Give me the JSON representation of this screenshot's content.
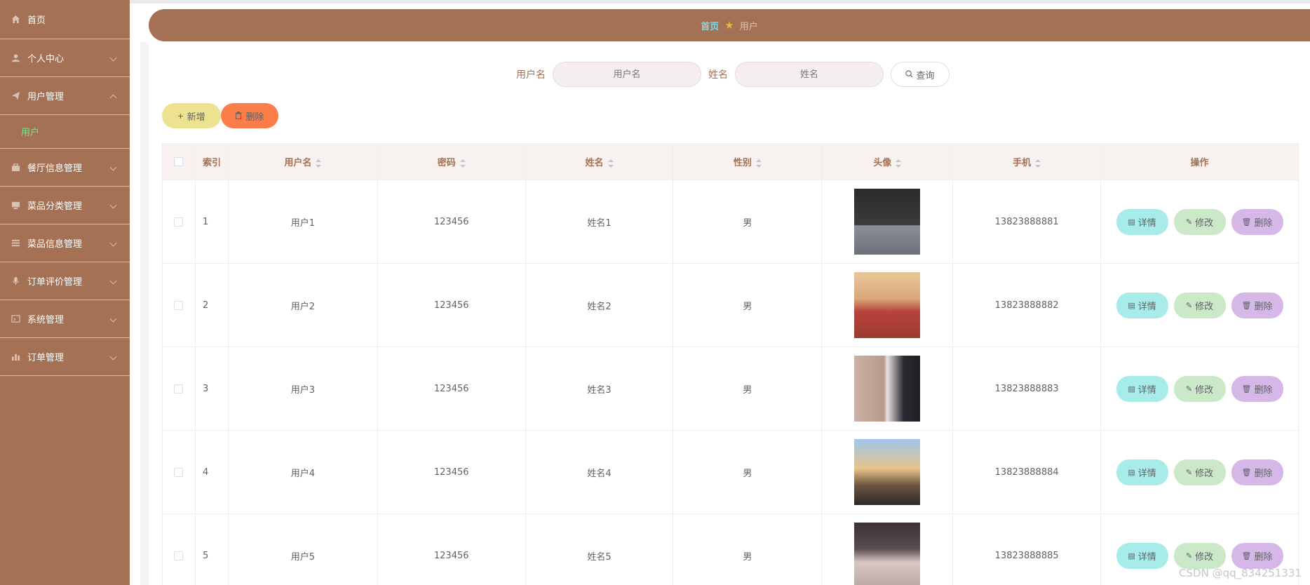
{
  "sidebar": {
    "items": [
      {
        "label": "首页",
        "icon": "home-icon",
        "chevron": false
      },
      {
        "label": "个人中心",
        "icon": "user-icon",
        "chevron": "down"
      },
      {
        "label": "用户管理",
        "icon": "send-icon",
        "chevron": "up"
      },
      {
        "label": "餐厅信息管理",
        "icon": "shop-icon",
        "chevron": "down"
      },
      {
        "label": "菜品分类管理",
        "icon": "monitor-icon",
        "chevron": "down"
      },
      {
        "label": "菜品信息管理",
        "icon": "list-icon",
        "chevron": "down"
      },
      {
        "label": "订单评价管理",
        "icon": "mic-icon",
        "chevron": "down"
      },
      {
        "label": "系统管理",
        "icon": "window-icon",
        "chevron": "down"
      },
      {
        "label": "订单管理",
        "icon": "chart-icon",
        "chevron": "down"
      }
    ],
    "sub_item": "用户"
  },
  "breadcrumb": {
    "home": "首页",
    "star": "★",
    "current": "用户"
  },
  "search": {
    "username_label": "用户名",
    "username_placeholder": "用户名",
    "name_label": "姓名",
    "name_placeholder": "姓名",
    "search_button": "查询"
  },
  "actions": {
    "add": "新增",
    "delete": "删除"
  },
  "table": {
    "headers": {
      "index": "索引",
      "username": "用户名",
      "password": "密码",
      "name": "姓名",
      "gender": "性别",
      "avatar": "头像",
      "phone": "手机",
      "ops": "操作"
    },
    "rows": [
      {
        "index": "1",
        "username": "用户1",
        "password": "123456",
        "name": "姓名1",
        "gender": "男",
        "phone": "13823888881"
      },
      {
        "index": "2",
        "username": "用户2",
        "password": "123456",
        "name": "姓名2",
        "gender": "男",
        "phone": "13823888882"
      },
      {
        "index": "3",
        "username": "用户3",
        "password": "123456",
        "name": "姓名3",
        "gender": "男",
        "phone": "13823888883"
      },
      {
        "index": "4",
        "username": "用户4",
        "password": "123456",
        "name": "姓名4",
        "gender": "男",
        "phone": "13823888884"
      },
      {
        "index": "5",
        "username": "用户5",
        "password": "123456",
        "name": "姓名5",
        "gender": "男",
        "phone": "13823888885"
      }
    ],
    "row_actions": {
      "detail": "详情",
      "edit": "修改",
      "delete": "删除"
    }
  },
  "watermark": "CSDN @qq_834251331",
  "colors": {
    "brand": "#a57155",
    "add": "#ece28f",
    "delete": "#fb7d4a",
    "detail": "#a7ece8",
    "edit": "#cbe8c8",
    "row_delete": "#d6b8e8",
    "active": "#7ee08a"
  }
}
